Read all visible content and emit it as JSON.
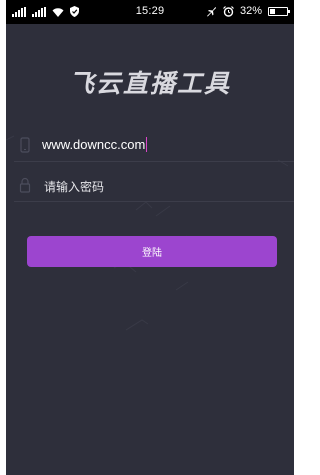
{
  "status_bar": {
    "time": "15:29",
    "battery_percent": "32%",
    "battery_level": 0.32,
    "icons": [
      "signal-bars-icon",
      "signal-bars-icon",
      "wifi-icon",
      "shield-icon",
      "airplane-silent-icon",
      "alarm-icon",
      "battery-icon"
    ]
  },
  "app": {
    "title": "飞云直播工具"
  },
  "login_form": {
    "username_value": "www.downcc.com",
    "username_icon": "phone-icon",
    "password_placeholder": "请输入密码",
    "password_icon": "lock-icon",
    "login_label": "登陆"
  },
  "colors": {
    "background": "#2e2f3b",
    "accent": "#9c45cf",
    "caret": "#d946c8",
    "status_bar": "#000000"
  }
}
